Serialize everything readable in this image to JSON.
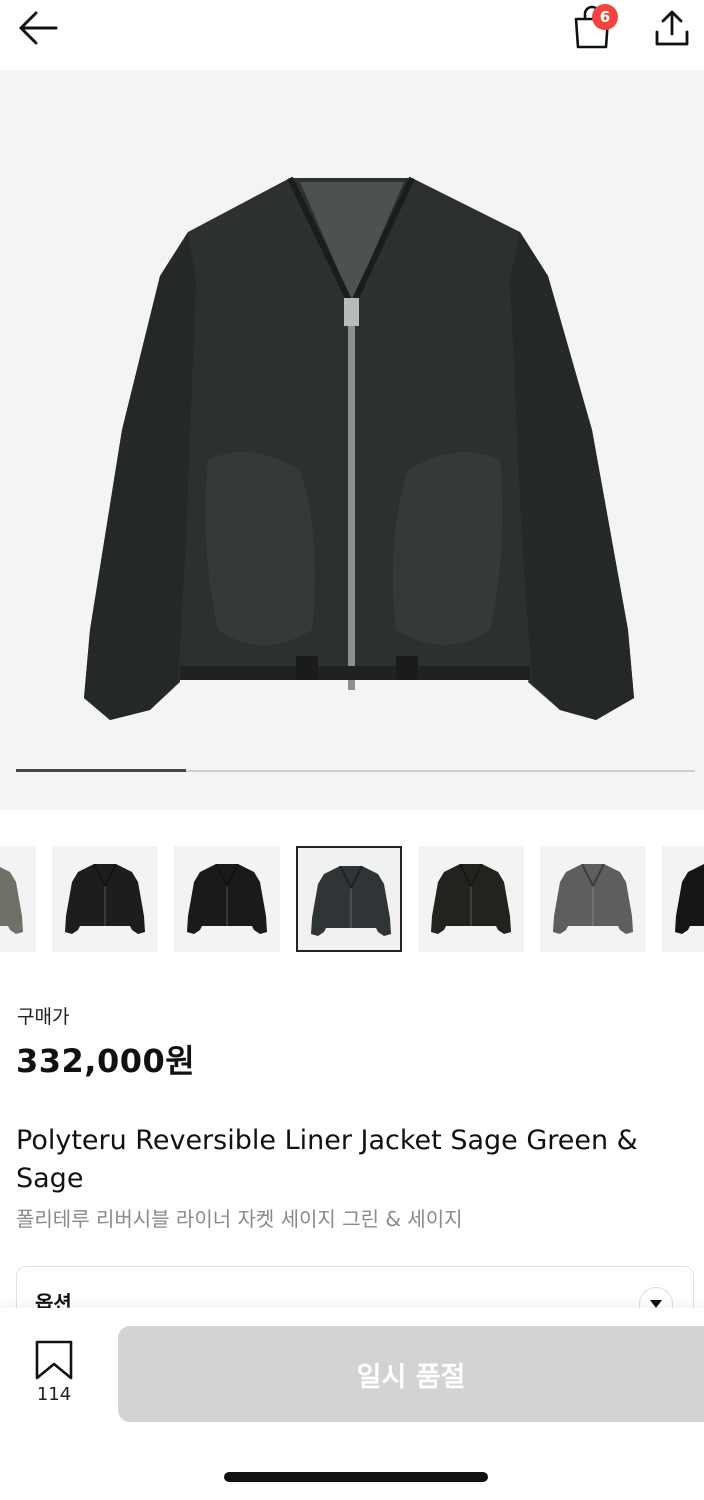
{
  "header": {
    "back_icon": "arrow-left-icon",
    "bag_icon": "shopping-bag-icon",
    "bag_count": "6",
    "share_icon": "share-upload-icon",
    "badge_color": "#f0463f"
  },
  "gallery": {
    "progress_fraction": 0.25,
    "thumbnails": [
      {
        "label": "jacket-thumb-1",
        "color": "#6f7169"
      },
      {
        "label": "jacket-thumb-2",
        "color": "#1d1d1d"
      },
      {
        "label": "jacket-thumb-3",
        "color": "#1a1a1a"
      },
      {
        "label": "jacket-thumb-4",
        "color": "#2f3537",
        "selected": true
      },
      {
        "label": "jacket-thumb-5",
        "color": "#24221e"
      },
      {
        "label": "jacket-thumb-6",
        "color": "#5e5e5c"
      },
      {
        "label": "jacket-thumb-7",
        "color": "#151515"
      }
    ]
  },
  "product": {
    "price_label": "구매가",
    "price": "332,000원",
    "title_en": "Polyteru Reversible Liner Jacket Sage Green & Sage",
    "title_ko": "폴리테루 리버시블 라이너 자켓 세이지 그린 & 세이지"
  },
  "options": {
    "label": "옵션"
  },
  "bottom": {
    "bookmark_count": "114",
    "soldout_label": "일시 품절",
    "soldout_color": "#d3d3d3"
  }
}
